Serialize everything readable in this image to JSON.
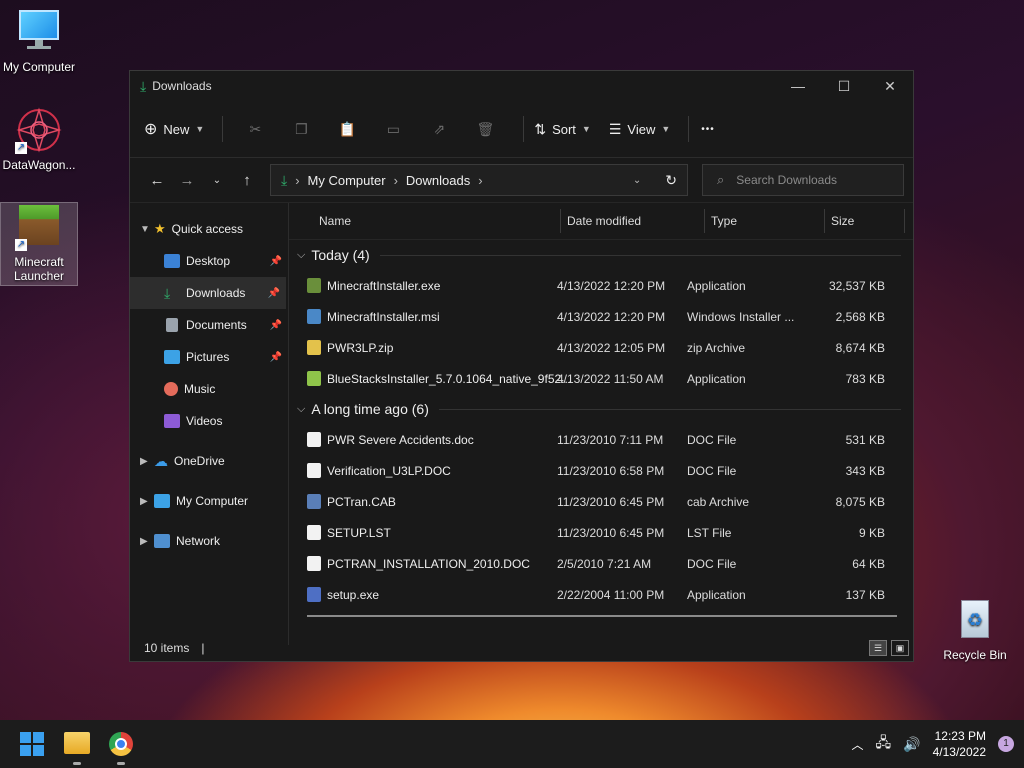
{
  "desktop": {
    "icons": [
      {
        "label": "My Computer",
        "icon": "monitor-icon"
      },
      {
        "label": "DataWagon...",
        "icon": "datawagon-icon"
      },
      {
        "label": "Minecraft Launcher",
        "icon": "minecraft-icon"
      },
      {
        "label": "Recycle Bin",
        "icon": "recycle-bin-icon"
      }
    ]
  },
  "window": {
    "title": "Downloads",
    "controls": {
      "minimize": "—",
      "maximize": "☐",
      "close": "✕"
    }
  },
  "toolbar": {
    "new_label": "New",
    "sort_label": "Sort",
    "view_label": "View",
    "more_label": "•••"
  },
  "address": {
    "crumbs": [
      "My Computer",
      "Downloads"
    ],
    "search_placeholder": "Search Downloads"
  },
  "sidebar": {
    "quick_access": "Quick access",
    "items": [
      {
        "label": "Desktop",
        "color": "#3b82d6",
        "pinned": true
      },
      {
        "label": "Downloads",
        "color": "#2fae6b",
        "pinned": true
      },
      {
        "label": "Documents",
        "color": "#9aa3ad",
        "pinned": true
      },
      {
        "label": "Pictures",
        "color": "#3ca2e6",
        "pinned": true
      },
      {
        "label": "Music",
        "color": "#e46b5b",
        "pinned": false
      },
      {
        "label": "Videos",
        "color": "#8d5bd6",
        "pinned": false
      }
    ],
    "onedrive": "OneDrive",
    "mycomputer": "My Computer",
    "network": "Network"
  },
  "columns": {
    "name": "Name",
    "date": "Date modified",
    "type": "Type",
    "size": "Size"
  },
  "groups": [
    {
      "label": "Today (4)",
      "files": [
        {
          "name": "MinecraftInstaller.exe",
          "date": "4/13/2022 12:20 PM",
          "type": "Application",
          "size": "32,537 KB",
          "color": "#6a8f3b"
        },
        {
          "name": "MinecraftInstaller.msi",
          "date": "4/13/2022 12:20 PM",
          "type": "Windows Installer ...",
          "size": "2,568 KB",
          "color": "#4a88c7"
        },
        {
          "name": "PWR3LP.zip",
          "date": "4/13/2022 12:05 PM",
          "type": "zip Archive",
          "size": "8,674 KB",
          "color": "#e3c24b"
        },
        {
          "name": "BlueStacksInstaller_5.7.0.1064_native_9f52...",
          "date": "4/13/2022 11:50 AM",
          "type": "Application",
          "size": "783 KB",
          "color": "#8fc44a"
        }
      ]
    },
    {
      "label": "A long time ago (6)",
      "files": [
        {
          "name": "PWR Severe Accidents.doc",
          "date": "11/23/2010 7:11 PM",
          "type": "DOC File",
          "size": "531 KB",
          "color": "#f2f2f2"
        },
        {
          "name": "Verification_U3LP.DOC",
          "date": "11/23/2010 6:58 PM",
          "type": "DOC File",
          "size": "343 KB",
          "color": "#f2f2f2"
        },
        {
          "name": "PCTran.CAB",
          "date": "11/23/2010 6:45 PM",
          "type": "cab Archive",
          "size": "8,075 KB",
          "color": "#5a7fb8"
        },
        {
          "name": "SETUP.LST",
          "date": "11/23/2010 6:45 PM",
          "type": "LST File",
          "size": "9 KB",
          "color": "#f2f2f2"
        },
        {
          "name": "PCTRAN_INSTALLATION_2010.DOC",
          "date": "2/5/2010 7:21 AM",
          "type": "DOC File",
          "size": "64 KB",
          "color": "#f2f2f2"
        },
        {
          "name": "setup.exe",
          "date": "2/22/2004 11:00 PM",
          "type": "Application",
          "size": "137 KB",
          "color": "#4e6fc4"
        }
      ]
    }
  ],
  "status": {
    "count": "10 items"
  },
  "taskbar": {
    "time": "12:23 PM",
    "date": "4/13/2022",
    "notifications": "1"
  }
}
